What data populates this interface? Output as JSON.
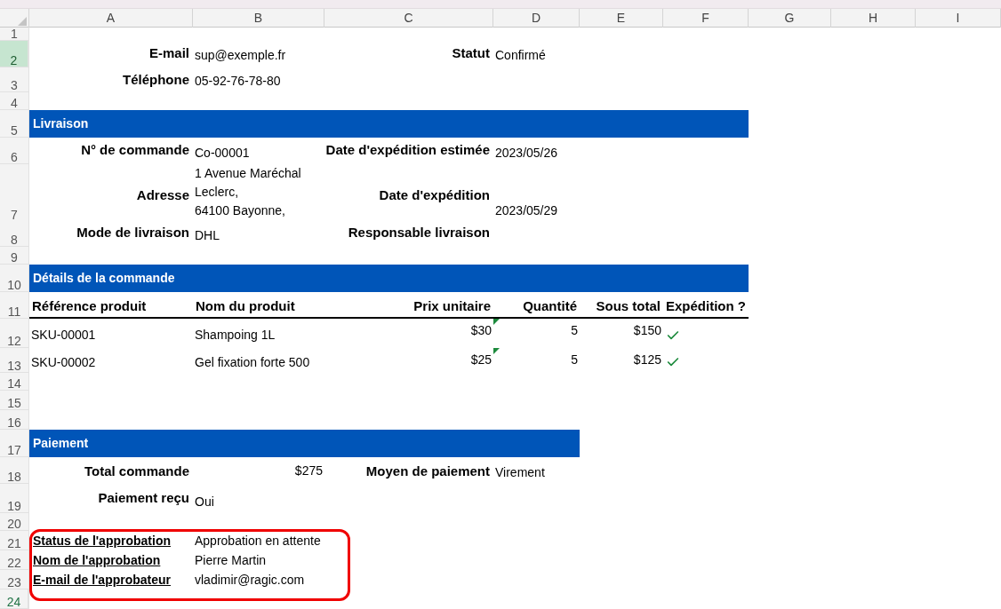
{
  "column_headers": [
    "A",
    "B",
    "C",
    "D",
    "E",
    "F",
    "G",
    "H",
    "I"
  ],
  "row_headers": [
    {
      "label": "1",
      "selected": false,
      "active": false
    },
    {
      "label": "2",
      "selected": true,
      "active": false
    },
    {
      "label": "3",
      "selected": false,
      "active": false
    },
    {
      "label": "4",
      "selected": false,
      "active": false
    },
    {
      "label": "5",
      "selected": false,
      "active": false
    },
    {
      "label": "6",
      "selected": false,
      "active": false
    },
    {
      "label": "7",
      "selected": false,
      "active": false
    },
    {
      "label": "8",
      "selected": false,
      "active": false
    },
    {
      "label": "9",
      "selected": false,
      "active": false
    },
    {
      "label": "10",
      "selected": false,
      "active": false
    },
    {
      "label": "11",
      "selected": false,
      "active": false
    },
    {
      "label": "12",
      "selected": false,
      "active": false
    },
    {
      "label": "13",
      "selected": false,
      "active": false
    },
    {
      "label": "14",
      "selected": false,
      "active": false
    },
    {
      "label": "15",
      "selected": false,
      "active": false
    },
    {
      "label": "16",
      "selected": false,
      "active": false
    },
    {
      "label": "17",
      "selected": false,
      "active": false
    },
    {
      "label": "18",
      "selected": false,
      "active": false
    },
    {
      "label": "19",
      "selected": false,
      "active": false
    },
    {
      "label": "20",
      "selected": false,
      "active": false
    },
    {
      "label": "21",
      "selected": false,
      "active": false
    },
    {
      "label": "22",
      "selected": false,
      "active": false
    },
    {
      "label": "23",
      "selected": false,
      "active": false
    },
    {
      "label": "24",
      "selected": false,
      "active": true
    }
  ],
  "client": {
    "email_label": "E-mail",
    "email": "sup@exemple.fr",
    "status_label": "Statut",
    "status": "Confirmé",
    "phone_label": "Téléphone",
    "phone": "05-92-76-78-80"
  },
  "delivery": {
    "title": "Livraison",
    "order_label": "N° de commande",
    "order": "Co-00001",
    "address_label": "Adresse",
    "address": [
      "1 Avenue Maréchal",
      "Leclerc,",
      "64100 Bayonne,"
    ],
    "estimated_label": "Date d'expédition estimée",
    "estimated": "2023/05/26",
    "shipped_label": "Date d'expédition",
    "shipped": "2023/05/29",
    "mode_label": "Mode de livraison",
    "mode": "DHL",
    "manager_label": "Responsable livraison"
  },
  "order_details": {
    "title": "Détails de la commande",
    "columns": [
      "Référence produit",
      "Nom du produit",
      "Prix unitaire",
      "Quantité",
      "Sous total",
      "Expédition ?"
    ],
    "rows": [
      {
        "sku": "SKU-00001",
        "name": "Shampoing 1L",
        "unit_price": "$30",
        "quantity": "5",
        "subtotal": "$150",
        "shipped": true
      },
      {
        "sku": "SKU-00002",
        "name": "Gel fixation forte 500",
        "unit_price": "$25",
        "quantity": "5",
        "subtotal": "$125",
        "shipped": true
      }
    ]
  },
  "payment": {
    "title": "Paiement",
    "total_label": "Total commande",
    "total": "$275",
    "method_label": "Moyen de paiement",
    "method": "Virement",
    "received_label": "Paiement reçu",
    "received": "Oui"
  },
  "approval": {
    "fields": [
      {
        "label": "Status de l'approbation",
        "value": "Approbation en attente"
      },
      {
        "label": "Nom de l'approbation",
        "value": "Pierre Martin"
      },
      {
        "label": "E-mail de l'approbateur",
        "value": "vladimir@ragic.com"
      }
    ]
  }
}
